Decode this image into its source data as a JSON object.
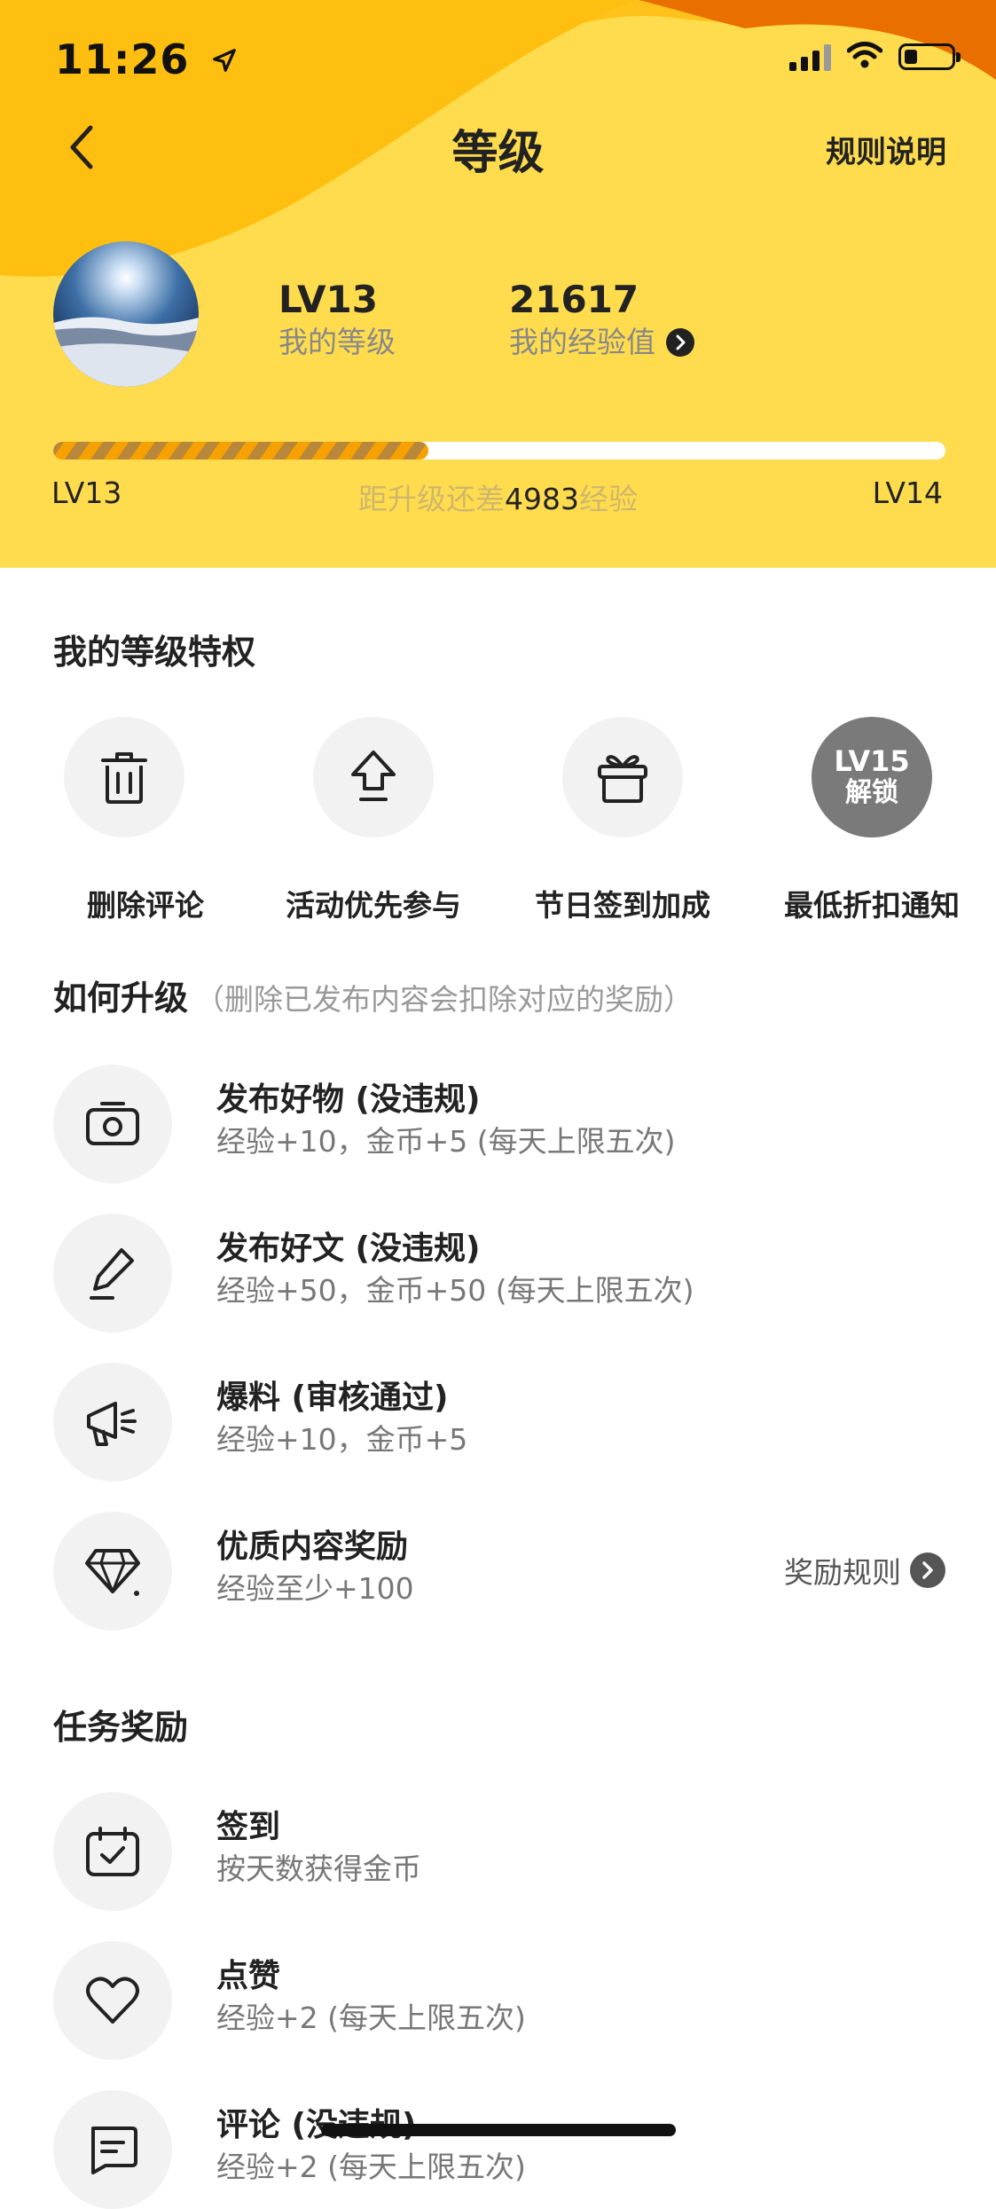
{
  "status": {
    "time": "11:26"
  },
  "nav": {
    "title": "等级",
    "rules": "规则说明"
  },
  "profile": {
    "level_value": "LV13",
    "level_label": "我的等级",
    "exp_value": "21617",
    "exp_label": "我的经验值"
  },
  "progress": {
    "current_level": "LV13",
    "next_level": "LV14",
    "gap_prefix": "距升级还差",
    "gap_value": "4983",
    "gap_suffix": "经验",
    "fraction": 0.42
  },
  "privileges": {
    "title": "我的等级特权",
    "items": [
      {
        "label": "删除评论",
        "icon": "trash-icon"
      },
      {
        "label": "活动优先参与",
        "icon": "upload-arrow-icon"
      },
      {
        "label": "节日签到加成",
        "icon": "gift-icon"
      },
      {
        "label": "最低折扣通知",
        "lock_level": "LV15",
        "lock_text": "解锁"
      }
    ]
  },
  "upgrade": {
    "title": "如何升级",
    "note": "（删除已发布内容会扣除对应的奖励）",
    "items": [
      {
        "title": "发布好物 (没违规)",
        "desc": "经验+10，金币+5 (每天上限五次)",
        "icon": "camera-icon"
      },
      {
        "title": "发布好文 (没违规)",
        "desc": "经验+50，金币+50 (每天上限五次)",
        "icon": "pencil-icon"
      },
      {
        "title": "爆料 (审核通过)",
        "desc": "经验+10，金币+5",
        "icon": "megaphone-icon"
      },
      {
        "title": "优质内容奖励",
        "desc": "经验至少+100",
        "icon": "diamond-icon",
        "side": "奖励规则"
      }
    ]
  },
  "tasks": {
    "title": "任务奖励",
    "items": [
      {
        "title": "签到",
        "desc": "按天数获得金币",
        "icon": "calendar-check-icon"
      },
      {
        "title": "点赞",
        "desc": "经验+2 (每天上限五次)",
        "icon": "heart-icon"
      },
      {
        "title": "评论 (没违规)",
        "desc": "经验+2 (每天上限五次)",
        "icon": "comment-icon"
      }
    ]
  },
  "colors": {
    "header_bg": "#ffdc4e",
    "header_wave": "#ffc21a",
    "header_corner": "#e96f00",
    "progress": "#f6a100"
  }
}
